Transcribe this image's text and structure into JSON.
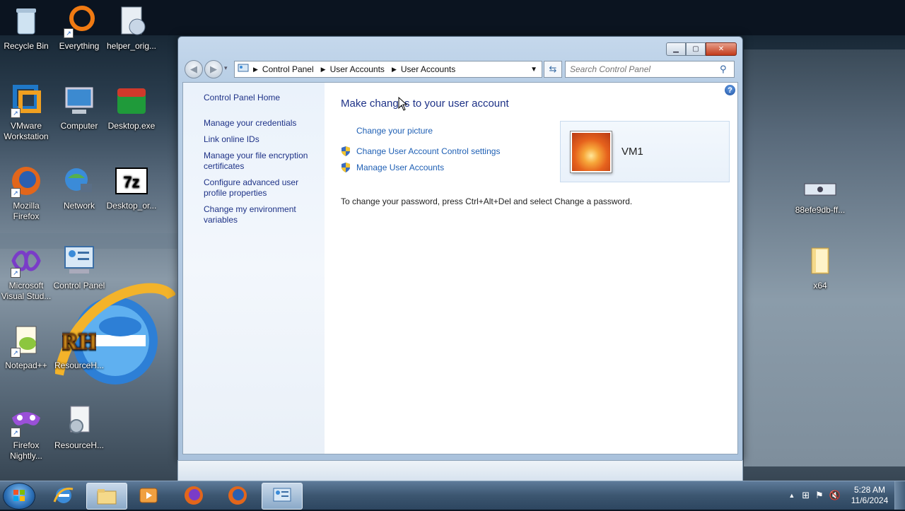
{
  "desktop": {
    "icons_left": [
      {
        "label": "Recycle Bin",
        "icon": "recycle-bin-icon"
      },
      {
        "label": "Everything",
        "icon": "everything-icon"
      },
      {
        "label": "helper_orig...",
        "icon": "helper-icon"
      },
      {
        "label": "VMware Workstation",
        "icon": "vmware-icon"
      },
      {
        "label": "Computer",
        "icon": "computer-icon"
      },
      {
        "label": "Desktop.exe",
        "icon": "desktop-exe-icon"
      },
      {
        "label": "Mozilla Firefox",
        "icon": "firefox-icon"
      },
      {
        "label": "Network",
        "icon": "network-icon"
      },
      {
        "label": "Desktop_or...",
        "icon": "7zip-icon"
      },
      {
        "label": "Microsoft Visual Stud...",
        "icon": "visual-studio-icon"
      },
      {
        "label": "Control Panel",
        "icon": "control-panel-icon"
      },
      {
        "label": "Notepad++",
        "icon": "notepadpp-icon"
      },
      {
        "label": "ResourceH...",
        "icon": "resource-hacker-icon"
      },
      {
        "label": "Firefox Nightly...",
        "icon": "firefox-nightly-icon"
      },
      {
        "label": "ResourceH...",
        "icon": "resource-hacker-config-icon"
      }
    ],
    "icons_right": [
      {
        "label": "88efe9db-ff...",
        "icon": "file-icon"
      },
      {
        "label": "x64",
        "icon": "folder-icon"
      }
    ]
  },
  "window": {
    "address": {
      "crumbs": [
        "Control Panel",
        "User Accounts",
        "User Accounts"
      ]
    },
    "search": {
      "placeholder": "Search Control Panel"
    },
    "left_pane": {
      "home": "Control Panel Home",
      "links": [
        "Manage your credentials",
        "Link online IDs",
        "Manage your file encryption certificates",
        "Configure advanced user profile properties",
        "Change my environment variables"
      ]
    },
    "main": {
      "heading": "Make changes to your user account",
      "tasks": [
        "Change your picture",
        "Change User Account Control settings",
        "Manage User Accounts"
      ],
      "user_name": "VM1",
      "password_note": "To change your password, press Ctrl+Alt+Del and select Change a password."
    }
  },
  "taskbar": {
    "time": "5:28 AM",
    "date": "11/6/2024"
  }
}
